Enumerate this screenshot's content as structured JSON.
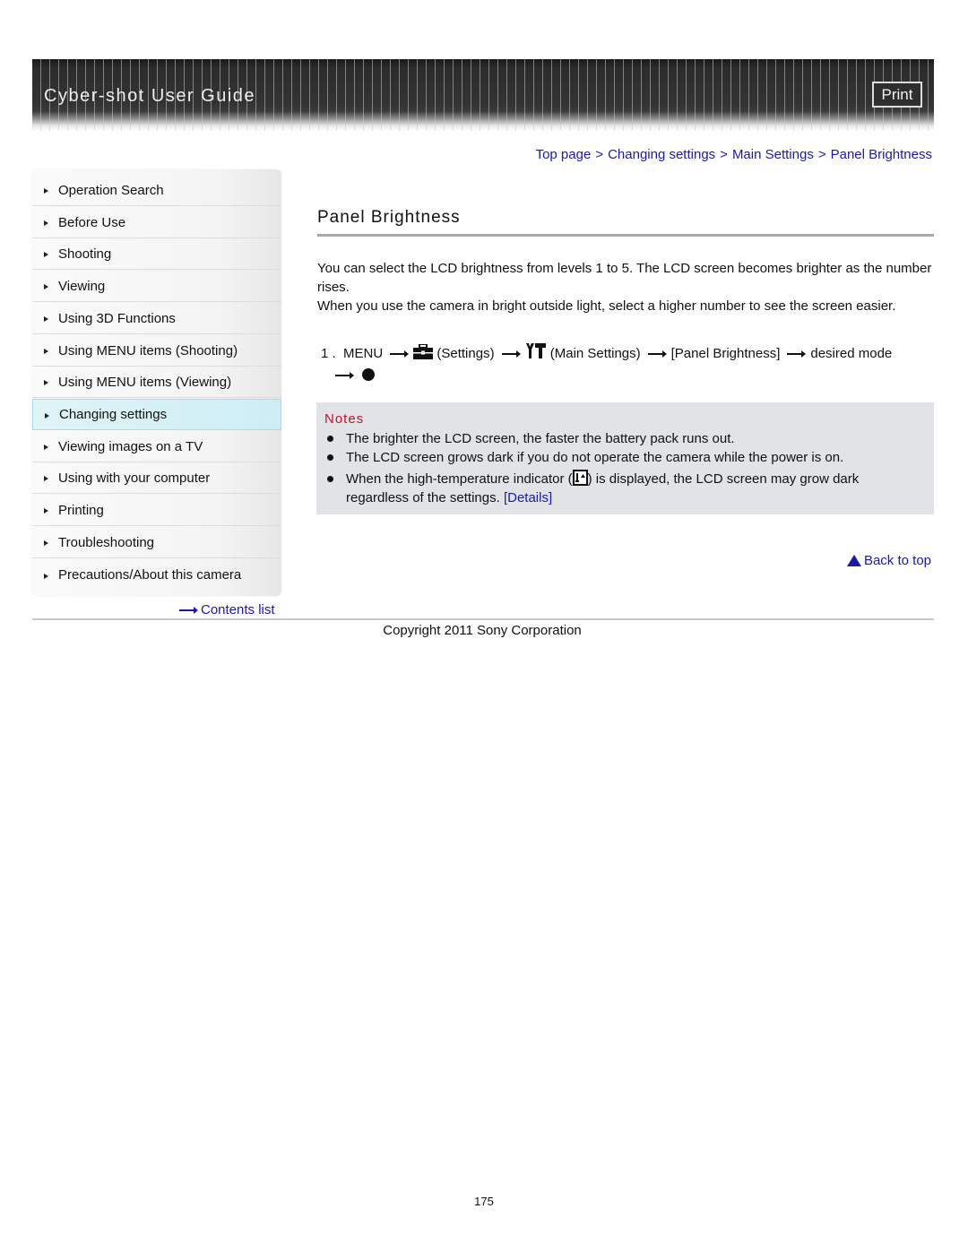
{
  "header": {
    "title": "Cyber-shot User Guide",
    "print_label": "Print"
  },
  "sidebar": {
    "active_index": 7,
    "items": [
      {
        "label": "Operation Search"
      },
      {
        "label": "Before Use"
      },
      {
        "label": "Shooting"
      },
      {
        "label": "Viewing"
      },
      {
        "label": "Using 3D Functions"
      },
      {
        "label": "Using MENU items (Shooting)"
      },
      {
        "label": "Using MENU items (Viewing)"
      },
      {
        "label": "Changing settings"
      },
      {
        "label": "Viewing images on a TV"
      },
      {
        "label": "Using with your computer"
      },
      {
        "label": "Printing"
      },
      {
        "label": "Troubleshooting"
      },
      {
        "label": "Precautions/About this camera"
      }
    ],
    "contents_list_label": "Contents list"
  },
  "breadcrumb": {
    "items": [
      "Top page",
      "Changing settings",
      "Main Settings",
      "Panel Brightness"
    ],
    "separator": ">"
  },
  "main": {
    "title": "Panel Brightness",
    "paragraphs": [
      "You can select the LCD brightness from levels 1 to 5. The LCD screen becomes brighter as the number rises.",
      "When you use the camera in bright outside light, select a higher number to see the screen easier."
    ],
    "step": {
      "number": "1 .",
      "menu": "MENU",
      "settings_icon": "toolbox-icon",
      "settings": "(Settings)",
      "main_settings_icon": "wrench-hammer-icon",
      "main_settings": "(Main Settings)",
      "panel_brightness": "[Panel Brightness]",
      "desired_mode": "desired mode",
      "final_icon": "filled-circle-icon"
    },
    "notes": {
      "title": "Notes",
      "items": [
        "The brighter the LCD screen, the faster the battery pack runs out.",
        "The LCD screen grows dark if you do not operate the camera while the power is on."
      ],
      "third": {
        "before": "When the high-temperature indicator (",
        "icon": "high-temperature-icon",
        "after": ") is displayed, the LCD screen may grow dark regardless of the settings.",
        "link": "[Details]"
      }
    },
    "back_to_top": "Back to top"
  },
  "footer": {
    "copyright": "Copyright 2011 Sony Corporation",
    "page_number": "175"
  },
  "colors": {
    "link": "#1a1aa6",
    "notes_title": "#c8102e",
    "notes_bg": "#e1e3e7",
    "active_nav_bg": "#dff4f8"
  }
}
